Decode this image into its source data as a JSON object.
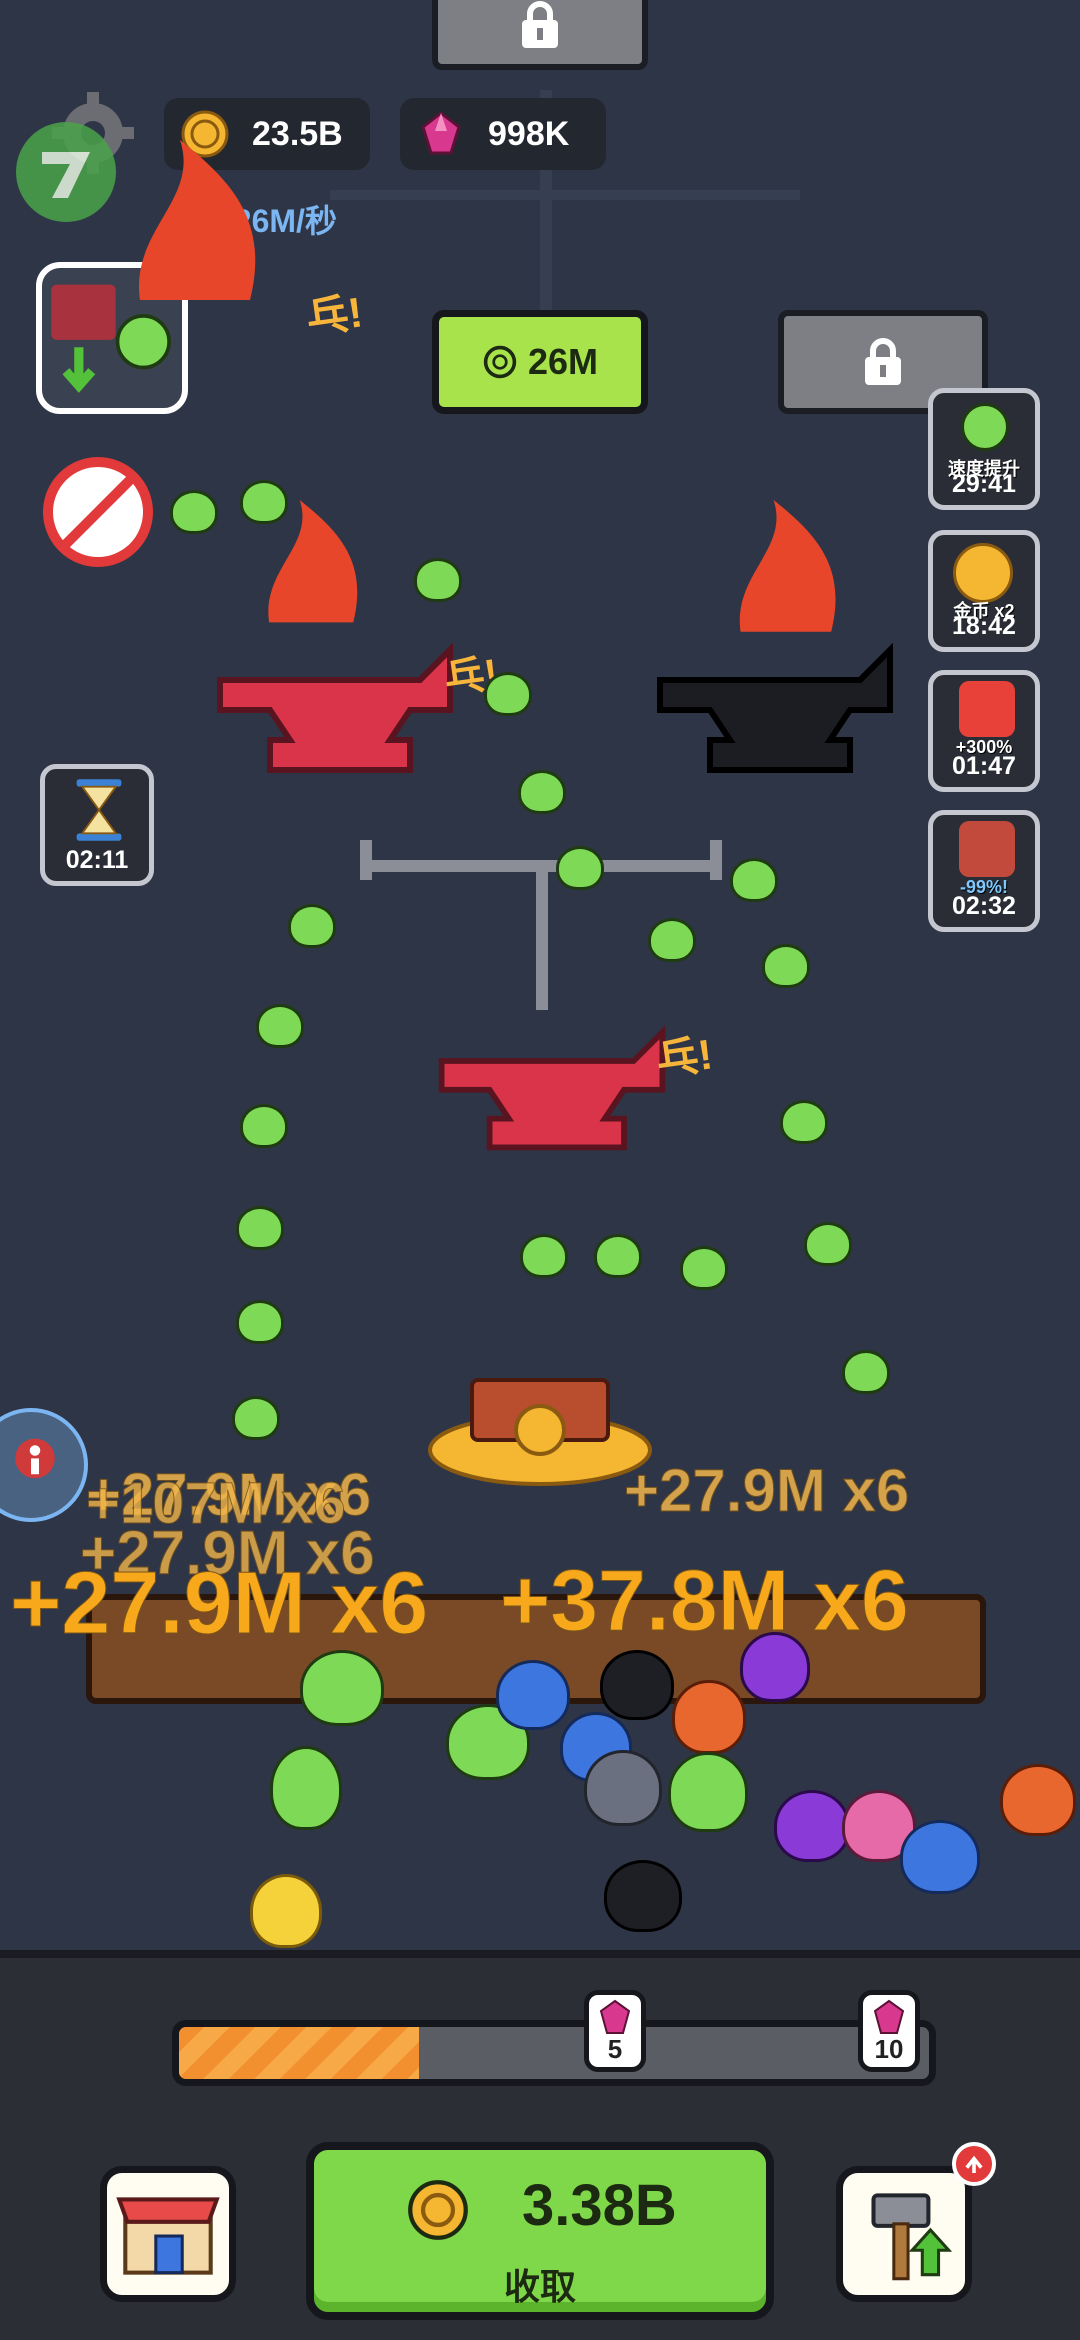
{
  "hud": {
    "coins": "23.5B",
    "gems": "998K",
    "income_rate": "426M/秒"
  },
  "upgrade_slot": {
    "price": "26M"
  },
  "boost_cards": [
    {
      "caption": "速度提升",
      "timer": "29:41"
    },
    {
      "caption": "金币 x2",
      "timer": "18:42"
    },
    {
      "caption": "+300%",
      "timer": "01:47"
    },
    {
      "caption": "-99%!",
      "timer": "02:32"
    }
  ],
  "hourglass": {
    "timer": "02:11"
  },
  "hit_text": "乓!",
  "floating_numbers": [
    "+27.9M x6",
    "+107M x6",
    "+27.9M x6",
    "+27.9M x6",
    "+37.8M x6",
    "+27.9M x6"
  ],
  "progress": {
    "fraction": 0.32,
    "marker_1": "5",
    "marker_2": "10"
  },
  "collect": {
    "amount": "3.38B",
    "label": "收取"
  },
  "colors": {
    "accent_green": "#7fd84a",
    "gold": "#f1b64c",
    "progress_orange": "#f2902f",
    "anvil_red": "#d9344a"
  }
}
